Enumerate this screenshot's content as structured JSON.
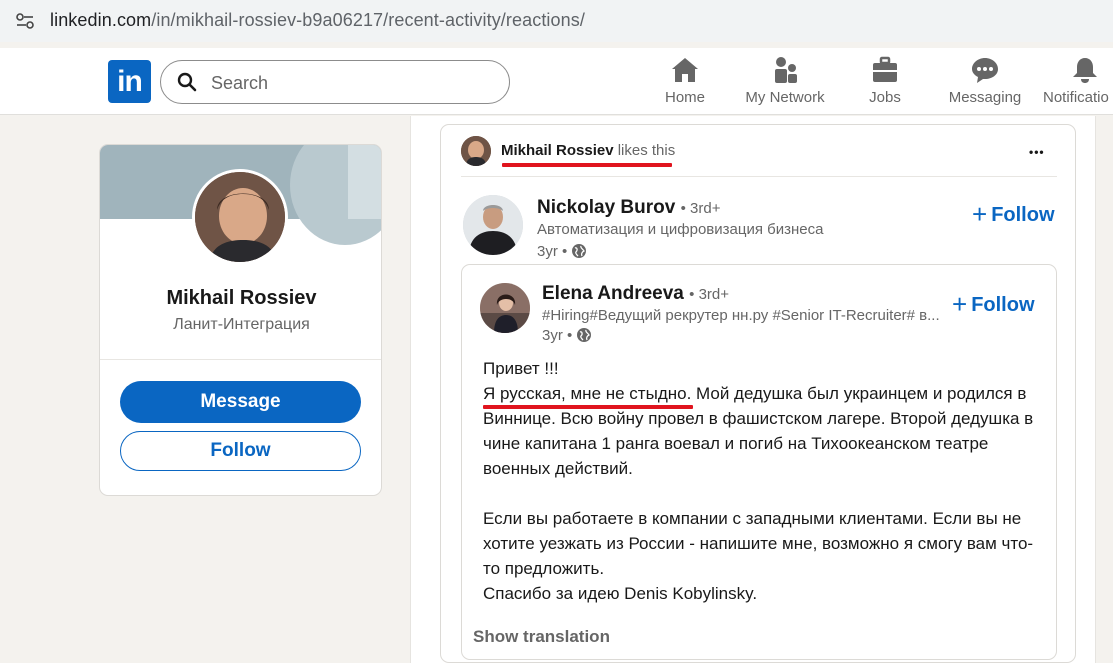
{
  "browser": {
    "url_host": "linkedin.com",
    "url_path": "/in/mikhail-rossiev-b9a06217/recent-activity/reactions/"
  },
  "header": {
    "logo_text": "in",
    "search_placeholder": "Search",
    "nav": [
      {
        "label": "Home",
        "icon": "home-icon"
      },
      {
        "label": "My Network",
        "icon": "network-icon"
      },
      {
        "label": "Jobs",
        "icon": "briefcase-icon"
      },
      {
        "label": "Messaging",
        "icon": "messaging-icon"
      },
      {
        "label": "Notificatio",
        "icon": "bell-icon"
      }
    ]
  },
  "profile": {
    "name": "Mikhail Rossiev",
    "company": "Ланит-Интеграция",
    "message_label": "Message",
    "follow_label": "Follow"
  },
  "activity": {
    "actor": "Mikhail Rossiev",
    "action": "likes this",
    "more_label": "•••",
    "poster": {
      "name": "Nickolay Burov",
      "degree": "• 3rd+",
      "headline": "Автоматизация и цифровизация бизнеса",
      "time": "3yr •",
      "follow_label": "Follow"
    },
    "shared": {
      "name": "Elena Andreeva",
      "degree": "• 3rd+",
      "headline": "#Hiring#Ведущий рекрутер нн.ру #Senior IT-Recruiter# в...",
      "time": "3yr •",
      "follow_label": "Follow",
      "body": [
        "Привет !!!",
        "Я русская, мне не стыдно. Мой дедушка был украинцем и родился в Виннице. Всю войну провел в фашистском лагере. Второй дедушка в чине капитана 1 ранга воевал и погиб на Тихоокеанском театре военных действий.",
        "Если вы работаете в компании с западными клиентами. Если вы  не хотите уезжать из России - напишите мне, возможно я смогу вам что-то предложить.",
        "Спасибо за идею Denis Kobylinsky."
      ],
      "show_translation": "Show translation"
    }
  },
  "colors": {
    "brand": "#0a66c2",
    "underline": "#e0141e",
    "page_bg": "#f4f2ee"
  }
}
